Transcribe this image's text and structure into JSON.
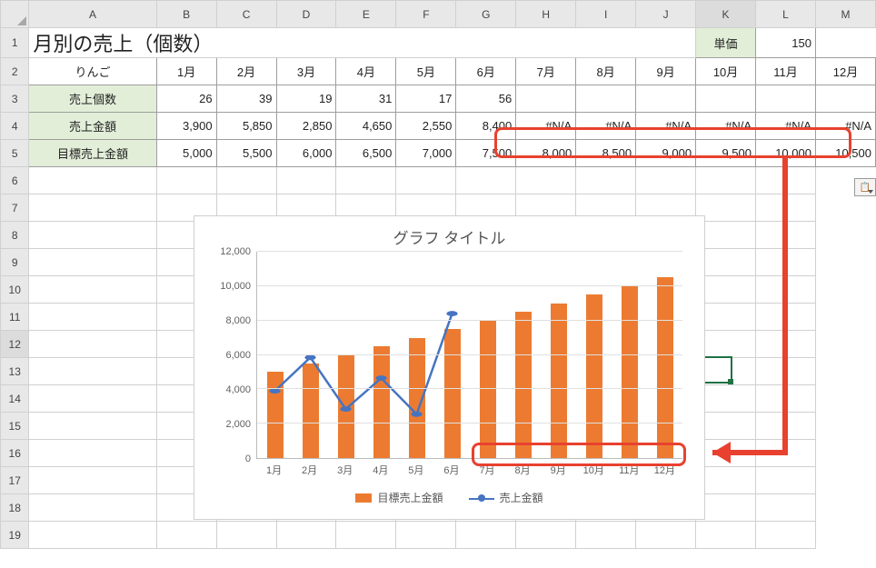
{
  "colHeaders": [
    "A",
    "B",
    "C",
    "D",
    "E",
    "F",
    "G",
    "H",
    "I",
    "J",
    "K",
    "L",
    "M"
  ],
  "rowHeaders": [
    "1",
    "2",
    "3",
    "4",
    "5",
    "6",
    "7",
    "8",
    "9",
    "10",
    "11",
    "12",
    "13",
    "14",
    "15",
    "16",
    "17",
    "18",
    "19"
  ],
  "title": "月別の売上（個数）",
  "unitLabel": "単価",
  "unitValue": "150",
  "rowLabels": {
    "product": "りんご",
    "qty": "売上個数",
    "sales": "売上金額",
    "target": "目標売上金額"
  },
  "months": [
    "1月",
    "2月",
    "3月",
    "4月",
    "5月",
    "6月",
    "7月",
    "8月",
    "9月",
    "10月",
    "11月",
    "12月"
  ],
  "qty": [
    "26",
    "39",
    "19",
    "31",
    "17",
    "56",
    "",
    "",
    "",
    "",
    "",
    ""
  ],
  "sales": [
    "3,900",
    "5,850",
    "2,850",
    "4,650",
    "2,550",
    "8,400",
    "#N/A",
    "#N/A",
    "#N/A",
    "#N/A",
    "#N/A",
    "#N/A"
  ],
  "target": [
    "5,000",
    "5,500",
    "6,000",
    "6,500",
    "7,000",
    "7,500",
    "8,000",
    "8,500",
    "9,000",
    "9,500",
    "10,000",
    "10,500"
  ],
  "chart": {
    "title": "グラフ タイトル",
    "legend": {
      "bar": "目標売上金額",
      "line": "売上金額"
    },
    "yTicks": [
      "0",
      "2,000",
      "4,000",
      "6,000",
      "8,000",
      "10,000",
      "12,000"
    ]
  },
  "chart_data": {
    "type": "bar",
    "categories": [
      "1月",
      "2月",
      "3月",
      "4月",
      "5月",
      "6月",
      "7月",
      "8月",
      "9月",
      "10月",
      "11月",
      "12月"
    ],
    "series": [
      {
        "name": "目標売上金額",
        "type": "bar",
        "values": [
          5000,
          5500,
          6000,
          6500,
          7000,
          7500,
          8000,
          8500,
          9000,
          9500,
          10000,
          10500
        ]
      },
      {
        "name": "売上金額",
        "type": "line",
        "values": [
          3900,
          5850,
          2850,
          4650,
          2550,
          8400,
          null,
          null,
          null,
          null,
          null,
          null
        ]
      }
    ],
    "title": "グラフ タイトル",
    "xlabel": "",
    "ylabel": "",
    "ylim": [
      0,
      12000
    ]
  }
}
